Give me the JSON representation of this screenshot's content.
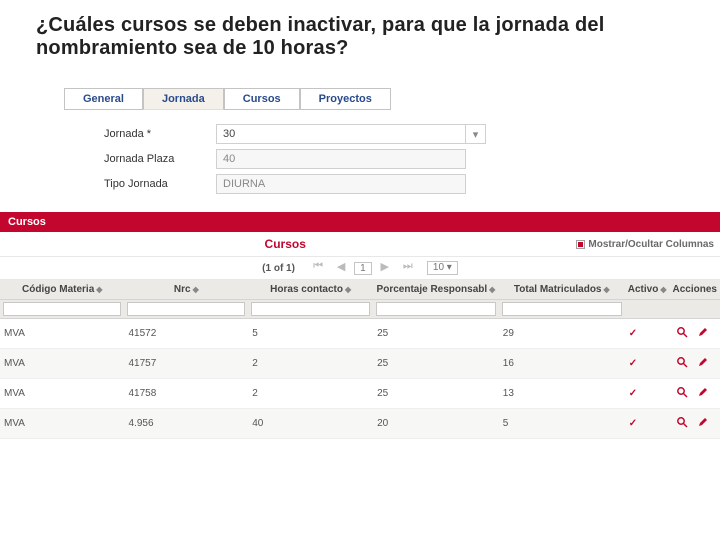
{
  "question": "¿Cuáles cursos se deben inactivar, para que la jornada del nombramiento sea de 10 horas?",
  "tabs": [
    {
      "label": "General"
    },
    {
      "label": "Jornada"
    },
    {
      "label": "Cursos"
    },
    {
      "label": "Proyectos"
    }
  ],
  "form": {
    "jornada_label": "Jornada *",
    "jornada_value": "30",
    "jornada_plaza_label": "Jornada Plaza",
    "jornada_plaza_value": "40",
    "tipo_jornada_label": "Tipo Jornada",
    "tipo_jornada_value": "DIURNA"
  },
  "section": {
    "title": "Cursos",
    "subtitle": "Cursos",
    "toggle_columns": "Mostrar/Ocultar Columnas"
  },
  "pager": {
    "info": "(1 of 1)",
    "page": "1",
    "size": "10"
  },
  "columns": {
    "codigo": "Código Materia",
    "nrc": "Nrc",
    "horas": "Horas contacto",
    "porcentaje": "Porcentaje Responsabl",
    "total": "Total Matriculados",
    "activo": "Activo",
    "acciones": "Acciones"
  },
  "rows": [
    {
      "codigo": "MVA",
      "nrc": "41572",
      "horas": "5",
      "porcentaje": "25",
      "total": "29",
      "activo": "✓"
    },
    {
      "codigo": "MVA",
      "nrc": "41757",
      "horas": "2",
      "porcentaje": "25",
      "total": "16",
      "activo": "✓"
    },
    {
      "codigo": "MVA",
      "nrc": "41758",
      "horas": "2",
      "porcentaje": "25",
      "total": "13",
      "activo": "✓"
    },
    {
      "codigo": "MVA",
      "nrc": "4.956",
      "horas": "40",
      "porcentaje": "20",
      "total": "5",
      "activo": "✓"
    }
  ]
}
